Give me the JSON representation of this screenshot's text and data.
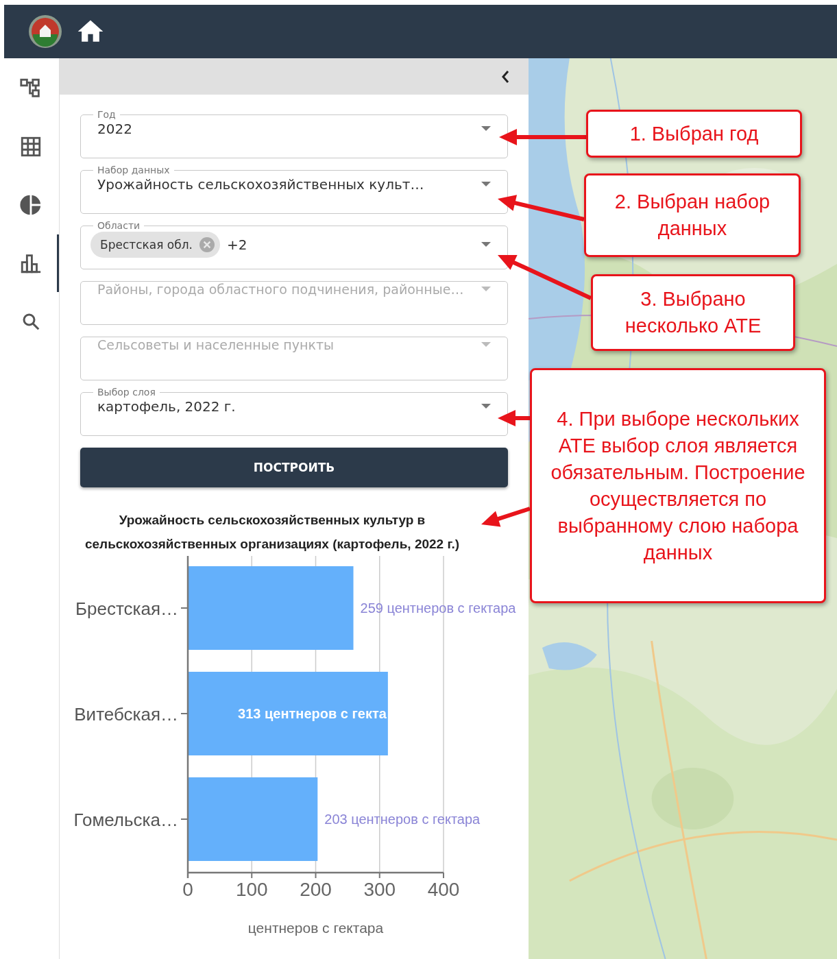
{
  "sidebar": {
    "items": [
      {
        "selected": false
      },
      {
        "selected": false
      },
      {
        "selected": false
      },
      {
        "selected": true
      },
      {
        "selected": false
      }
    ]
  },
  "form": {
    "fields": [
      {
        "kind": "select",
        "label": "Год",
        "value": "2022"
      },
      {
        "kind": "select",
        "label": "Набор данных",
        "value": "Урожайность сельскохозяйственных культ…"
      },
      {
        "kind": "chips",
        "label": "Области",
        "chips": [
          "Брестская обл."
        ],
        "more": "+2"
      },
      {
        "kind": "select",
        "placeholder": "Районы, города областного подчинения, районные…"
      },
      {
        "kind": "select",
        "placeholder": "Сельсоветы и населенные пункты"
      },
      {
        "kind": "select",
        "label": "Выбор слоя",
        "value": "картофель, 2022 г."
      }
    ],
    "submit": "ПОСТРОИТЬ"
  },
  "chart_data": {
    "type": "bar",
    "orientation": "horizontal",
    "title": "Урожайность сельскохозяйственных культур в сельскохозяйственных организациях (картофель, 2022 г.)",
    "xlabel": "центнеров с гектара",
    "categories": [
      "Брестская…",
      "Витебская…",
      "Гомельска…"
    ],
    "values": [
      259,
      313,
      203
    ],
    "xlim": [
      0,
      400
    ],
    "xticks": [
      0,
      100,
      200,
      300,
      400
    ],
    "grid": true,
    "value_labels": [
      "259 центнеров с гектара",
      "313 центнеров с гекта",
      "203 центнеров с гектара"
    ]
  },
  "callouts": [
    {
      "text": "1. Выбран год"
    },
    {
      "text": "2. Выбран набор данных"
    },
    {
      "text": "3. Выбрано несколько АТЕ"
    },
    {
      "text": "4. При выборе нескольких АТЕ выбор слоя является обязательным. Построение осуществляется по выбранному слою набора данных"
    }
  ]
}
